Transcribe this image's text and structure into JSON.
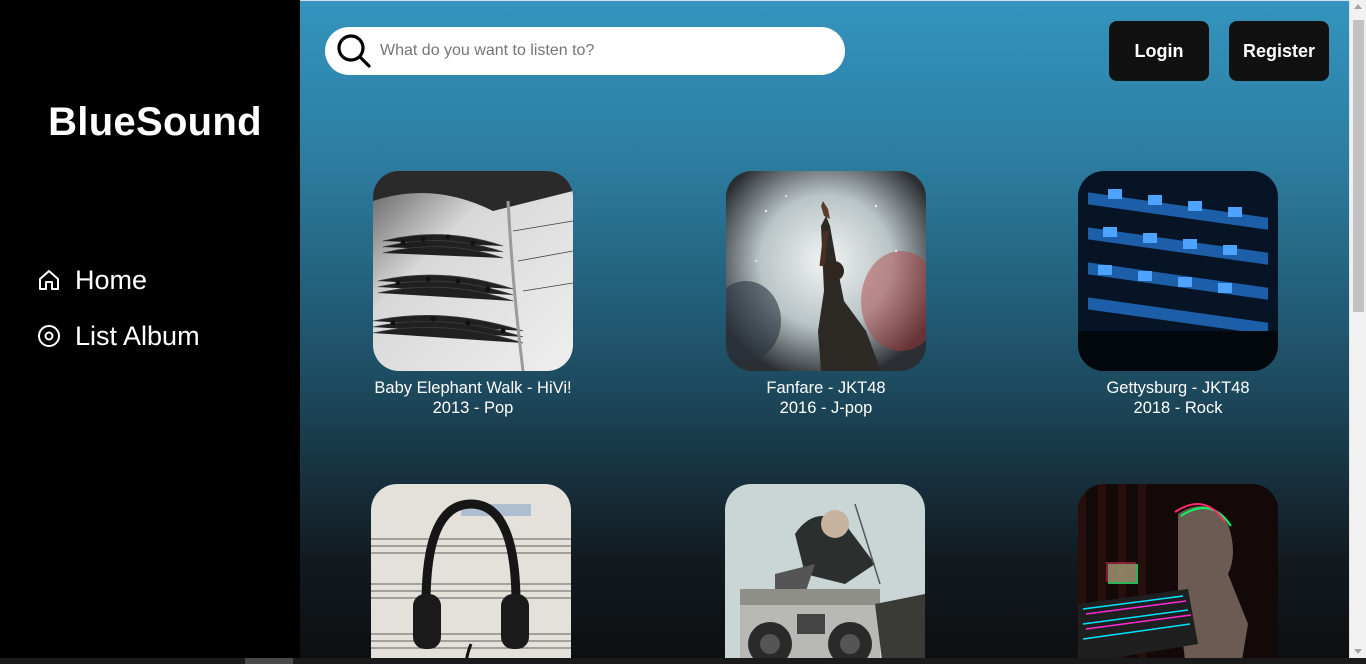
{
  "brand": "BlueSound",
  "nav": [
    {
      "label": "Home",
      "icon": "home-icon"
    },
    {
      "label": "List Album",
      "icon": "disc-icon"
    }
  ],
  "search": {
    "placeholder": "What do you want to listen to?",
    "value": "",
    "icon": "search-icon"
  },
  "auth": {
    "login": "Login",
    "register": "Register"
  },
  "albums": [
    {
      "title": "Baby Elephant Walk - HiVi!",
      "meta": "2013 - Pop",
      "cover": "sheet-music"
    },
    {
      "title": "Fanfare - JKT48",
      "meta": "2016 - J-pop",
      "cover": "concert-smoke"
    },
    {
      "title": "Gettysburg - JKT48",
      "meta": "2018 - Rock",
      "cover": "mixing-console"
    },
    {
      "title": "",
      "meta": "",
      "cover": "headphones-on-sheet"
    },
    {
      "title": "",
      "meta": "",
      "cover": "boombox"
    },
    {
      "title": "",
      "meta": "",
      "cover": "glitch-keyboard"
    }
  ],
  "colors": {
    "sidebar": "#000000",
    "accent_top": "#3494be",
    "accent_bottom": "#0d0f11",
    "button": "#111111"
  }
}
